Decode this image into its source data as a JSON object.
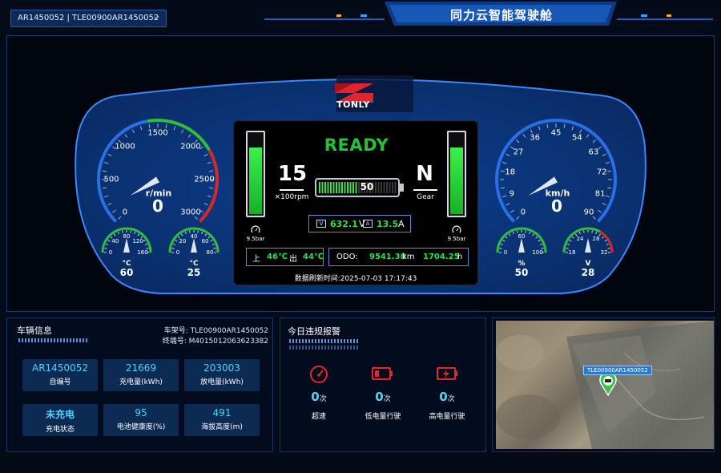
{
  "header": {
    "vehicle_selector": "AR1450052 | TLE00900AR1450052",
    "title": "同力云智能驾驶舱"
  },
  "brand": {
    "logo_text": "TONLY"
  },
  "rpm_gauge": {
    "ticks": [
      "0",
      "500",
      "1000",
      "1500",
      "2000",
      "2500",
      "3000"
    ],
    "unit": "r/min",
    "value": "0"
  },
  "speed_gauge": {
    "ticks": [
      "0",
      "9",
      "18",
      "27",
      "36",
      "45",
      "54",
      "63",
      "72",
      "81",
      "90"
    ],
    "unit": "km/h",
    "value": "0"
  },
  "small_gauges": [
    {
      "ticks": [
        "0",
        "40",
        "80",
        "120",
        "160"
      ],
      "unit": "°C",
      "value": "60"
    },
    {
      "ticks": [
        "0",
        "20",
        "40",
        "60",
        "80"
      ],
      "unit": "°C",
      "value": "25"
    },
    {
      "ticks": [
        "0",
        "60",
        "100"
      ],
      "unit": "%",
      "value": "50"
    },
    {
      "ticks": [
        "18",
        "24",
        "28",
        "32"
      ],
      "unit": "V",
      "value": "28"
    }
  ],
  "center": {
    "status": "READY",
    "rpm_display": "15",
    "rpm_unit": "×100rpm",
    "gear": "N",
    "gear_label": "Gear",
    "battery_percent": "50",
    "battery_level": 0.5,
    "pressure_left": "9.5bar",
    "pressure_right": "9.5bar",
    "pressure_left_level": 0.8,
    "pressure_right_level": 0.8,
    "voltage_tag": "V",
    "voltage": "632.1",
    "voltage_unit": "V",
    "current_tag": "A",
    "current": "13.5",
    "current_unit": "A",
    "temp_in_icon": "上",
    "temp_in": "46℃",
    "temp_out_icon": "出",
    "temp_out": "44℃",
    "odo_label": "ODO:",
    "odo_value": "9541.38",
    "odo_unit": "km",
    "hours_value": "1704.25",
    "hours_unit": "h",
    "refresh_time": "数据刷新时间:2025-07-03 17:17:43"
  },
  "vehicle_info": {
    "title": "车辆信息",
    "frame_label": "车架号: TLE00900AR1450052",
    "terminal_label": "终端号: M4015012063623382",
    "cards": [
      {
        "value": "AR1450052",
        "label": "自编号"
      },
      {
        "value": "21669",
        "label": "充电量(kWh)"
      },
      {
        "value": "203003",
        "label": "放电量(kWh)"
      },
      {
        "value": "未充电",
        "label": "充电状态"
      },
      {
        "value": "95",
        "label": "电池健康度(%)"
      },
      {
        "value": "491",
        "label": "海拔高度(m)"
      }
    ]
  },
  "alarms": {
    "title": "今日违规报警",
    "items": [
      {
        "count": "0",
        "unit": "次",
        "label": "超速"
      },
      {
        "count": "0",
        "unit": "次",
        "label": "低电量行驶"
      },
      {
        "count": "0",
        "unit": "次",
        "label": "高电量行驶"
      }
    ]
  },
  "map": {
    "marker_label": "TLE00900AR1450052"
  },
  "colors": {
    "accent": "#2fe04a",
    "value_blue": "#4fd2ff",
    "gauge_red": "#d42a2a"
  }
}
